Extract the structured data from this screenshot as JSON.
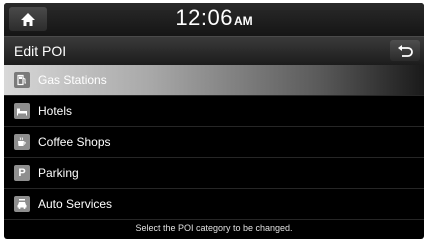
{
  "status_bar": {
    "home_icon": "home-icon",
    "time": "12:06",
    "ampm": "AM"
  },
  "header": {
    "title": "Edit POI",
    "back_icon": "back-arrow-icon"
  },
  "poi_categories": [
    {
      "label": "Gas Stations",
      "icon": "gas-pump-icon",
      "selected": true
    },
    {
      "label": "Hotels",
      "icon": "bed-icon",
      "selected": false
    },
    {
      "label": "Coffee Shops",
      "icon": "coffee-cup-icon",
      "selected": false
    },
    {
      "label": "Parking",
      "icon": "parking-icon",
      "icon_text": "P",
      "selected": false
    },
    {
      "label": "Auto Services",
      "icon": "car-service-icon",
      "selected": false
    }
  ],
  "footer": {
    "hint": "Select the POI category to be changed."
  }
}
